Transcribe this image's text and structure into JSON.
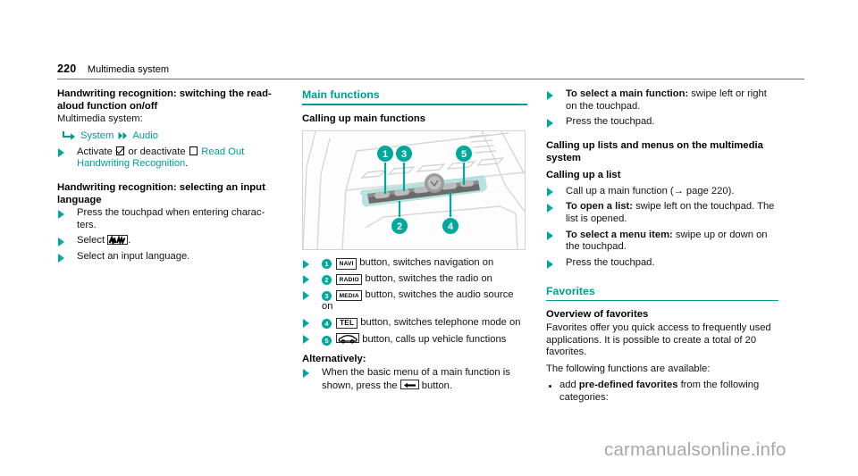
{
  "header": {
    "page_number": "220",
    "chapter_title": "Multimedia system"
  },
  "column_left": {
    "heading_1": "Handwriting recognition: switching the read-aloud function on/off",
    "intro": "Multimedia system:",
    "nav_path": {
      "first_icon": "corner-arrow-icon",
      "first_label": "System",
      "second_icon": "double-chevron-icon",
      "second_label": "Audio"
    },
    "step_activate_pre": "Activate",
    "step_activate_mid": "or deactivate",
    "step_activate_link": "Read Out Handwriting Recognition",
    "step_activate_end": ".",
    "heading_2": "Handwriting recognition: selecting an input language",
    "step_press": "Press the touchpad when entering charac-ters.",
    "step_select_pre": "Select",
    "step_select_icon": "handwriting-icon",
    "step_select_end": ".",
    "step_language": "Select an input language."
  },
  "column_middle": {
    "section_title": "Main functions",
    "subheading": "Calling up main functions",
    "illustration_alt": "Centre console control panel with numbered callouts 1 to 5",
    "callouts": [
      "1",
      "2",
      "3",
      "4",
      "5"
    ],
    "items": [
      {
        "num": "1",
        "key": "NAVI",
        "key_type": "text",
        "text": "button, switches navigation on"
      },
      {
        "num": "2",
        "key": "RADIO",
        "key_type": "text",
        "text": "button, switches the radio on"
      },
      {
        "num": "3",
        "key": "MEDIA",
        "key_type": "text",
        "text": "button, switches the audio source on"
      },
      {
        "num": "4",
        "key": "TEL",
        "key_type": "text",
        "text": "button, switches telephone mode on"
      },
      {
        "num": "5",
        "key": "car-icon",
        "key_type": "glyph",
        "text": "button, calls up vehicle functions"
      }
    ],
    "alternatively_heading": "Alternatively:",
    "alternatively_step_pre": "When the basic menu of a main function is shown, press the",
    "alternatively_step_icon": "back-button-icon",
    "alternatively_step_end": "button."
  },
  "column_right": {
    "step_select_main_bold": "To select a main function:",
    "step_select_main_rest": "swipe left or right on the touchpad.",
    "step_press_touchpad_1": "Press the touchpad.",
    "heading_lists_menus": "Calling up lists and menus on the multimedia system",
    "heading_calling_list": "Calling up a list",
    "step_call_main": "Call up a main function (→ page 220).",
    "step_open_list_bold": "To open a list:",
    "step_open_list_rest": "swipe left on the touchpad. The list is opened.",
    "step_select_item_bold": "To select a menu item:",
    "step_select_item_rest": "swipe up or down on the touchpad.",
    "step_press_touchpad_2": "Press the touchpad.",
    "favorites_title": "Favorites",
    "favorites_subheading": "Overview of favorites",
    "favorites_body": "Favorites offer you quick access to frequently used applications. It is possible to create a total of 20 favorites.",
    "favorites_available": "The following functions are available:",
    "bullet_add_pre": "add",
    "bullet_add_bold": "pre-defined favorites",
    "bullet_add_rest": "from the following categories:"
  },
  "watermark": {
    "text": "carmanualsonline.info"
  },
  "colors": {
    "teal": "#009a93",
    "teal_bright": "#00a79d",
    "teal_pale": "#cdeeec",
    "text": "#111111",
    "rule": "#6f6f6f",
    "watermark": "#a7a7a7"
  }
}
